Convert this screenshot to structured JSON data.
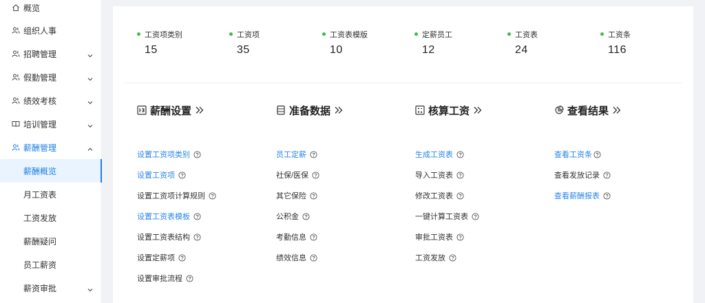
{
  "sidebar": {
    "items": [
      {
        "label": "概览",
        "icon": "home-icon"
      },
      {
        "label": "组织人事",
        "icon": "people-icon"
      },
      {
        "label": "招聘管理",
        "icon": "people-icon"
      },
      {
        "label": "假勤管理",
        "icon": "people-icon"
      },
      {
        "label": "绩效考核",
        "icon": "people-icon"
      },
      {
        "label": "培训管理",
        "icon": "book-icon"
      },
      {
        "label": "薪酬管理",
        "icon": "people-icon"
      }
    ],
    "sub_items": [
      {
        "label": "薪酬概览"
      },
      {
        "label": "月工资表"
      },
      {
        "label": "工资发放"
      },
      {
        "label": "薪酬疑问"
      },
      {
        "label": "员工薪资"
      },
      {
        "label": "薪资审批"
      }
    ]
  },
  "stats": [
    {
      "label": "工资项类别",
      "value": "15"
    },
    {
      "label": "工资项",
      "value": "35"
    },
    {
      "label": "工资表模版",
      "value": "10"
    },
    {
      "label": "定薪员工",
      "value": "12"
    },
    {
      "label": "工资表",
      "value": "24"
    },
    {
      "label": "工资条",
      "value": "116"
    }
  ],
  "sections": [
    {
      "title": "薪酬设置",
      "icon": "salary-settings-icon",
      "links": [
        {
          "label": "设置工资项类别"
        },
        {
          "label": "设置工资项"
        },
        {
          "label": "设置工资项计算规则"
        },
        {
          "label": "设置工资表模板"
        },
        {
          "label": "设置工资表结构"
        },
        {
          "label": "设置定薪项"
        },
        {
          "label": "设置审批流程"
        }
      ]
    },
    {
      "title": "准备数据",
      "icon": "document-list-icon",
      "links": [
        {
          "label": "员工定薪"
        },
        {
          "label": "社保/医保"
        },
        {
          "label": "其它保险"
        },
        {
          "label": "公积金"
        },
        {
          "label": "考勤信息"
        },
        {
          "label": "绩效信息"
        }
      ]
    },
    {
      "title": "核算工资",
      "icon": "calculator-icon",
      "links": [
        {
          "label": "生成工资表"
        },
        {
          "label": "导入工资表"
        },
        {
          "label": "修改工资表"
        },
        {
          "label": "一键计算工资表"
        },
        {
          "label": "审批工资表"
        },
        {
          "label": "工资发放"
        }
      ]
    },
    {
      "title": "查看结果",
      "icon": "pie-chart-icon",
      "links": [
        {
          "label": "查看工资条"
        },
        {
          "label": "查看发放记录"
        },
        {
          "label": "查看薪酬报表"
        }
      ]
    }
  ],
  "colors": {
    "accent": "#1d7fe6",
    "link_blue": "#2a86e8",
    "stat_dot": "#3dbb4c",
    "active_bg": "#e9f4ff"
  }
}
